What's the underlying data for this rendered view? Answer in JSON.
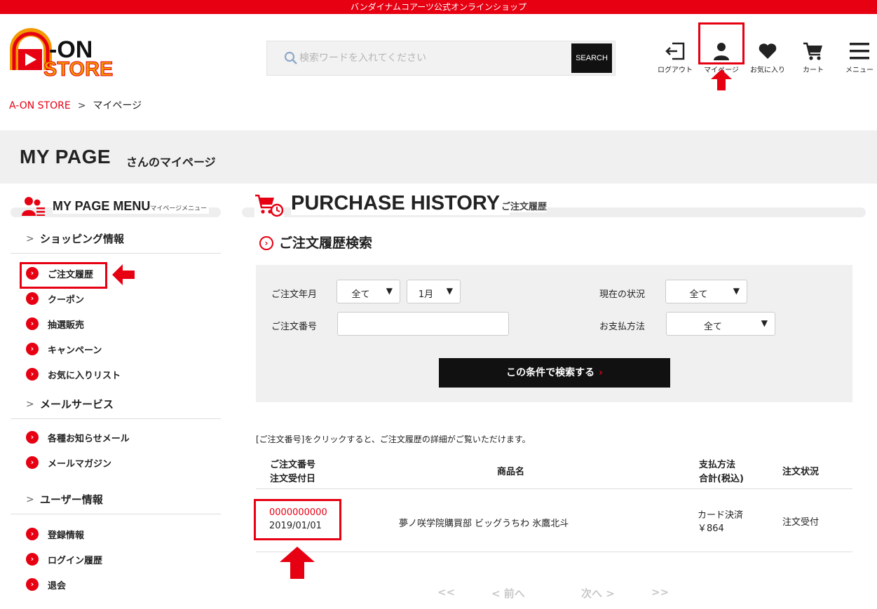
{
  "topbar": {
    "text": "バンダイナムコアーツ公式オンラインショップ"
  },
  "logo": {
    "alt": "A-ON STORE"
  },
  "search": {
    "placeholder": "検索ワードを入れてください",
    "button": "SEARCH"
  },
  "header_icons": [
    {
      "icon": "logout-icon",
      "label": "ログアウト"
    },
    {
      "icon": "user-icon",
      "label": "マイページ"
    },
    {
      "icon": "heart-icon",
      "label": "お気に入り"
    },
    {
      "icon": "cart-icon",
      "label": "カート"
    },
    {
      "icon": "hamburger-icon",
      "label": "メニュー"
    }
  ],
  "breadcrumb": {
    "home": "A-ON STORE",
    "sep": ">",
    "current": "マイページ"
  },
  "page": {
    "title": "MY PAGE",
    "subtitle": "さんのマイページ"
  },
  "sidebar": {
    "title": "MY PAGE MENU",
    "title_sub": "マイページメニュー",
    "sections": [
      {
        "label": "ショッピング情報",
        "items": [
          "ご注文履歴",
          "クーポン",
          "抽選販売",
          "キャンペーン",
          "お気に入りリスト"
        ]
      },
      {
        "label": "メールサービス",
        "items": [
          "各種お知らせメール",
          "メールマガジン"
        ]
      },
      {
        "label": "ユーザー情報",
        "items": [
          "登録情報",
          "ログイン履歴",
          "退会"
        ]
      }
    ]
  },
  "purchase_history": {
    "title": "PURCHASE HISTORY",
    "subtitle": "ご注文履歴",
    "search_heading": "ご注文履歴検索",
    "filters": {
      "order_date_label": "ご注文年月",
      "year_value": "全て",
      "month_value": "1月",
      "order_no_label": "ご注文番号",
      "order_no_value": "",
      "status_label": "現在の状況",
      "status_value": "全て",
      "payment_label": "お支払方法",
      "payment_value": "全て",
      "submit": "この条件で検索する"
    },
    "note": "[ご注文番号]をクリックすると、ご注文履歴の詳細がご覧いただけます。",
    "columns": {
      "order_no": "ご注文番号",
      "order_date": "注文受付日",
      "product": "商品名",
      "payment": "支払方法",
      "total": "合計(税込)",
      "status": "注文状況"
    },
    "rows": [
      {
        "order_no": "0000000000",
        "date": "2019/01/01",
        "product": "夢ノ咲学院購買部 ビッグうちわ 氷鷹北斗",
        "payment": "カード決済",
        "total": "￥864",
        "status": "注文受付"
      }
    ],
    "pager": {
      "first": "<<",
      "prev": "< 前へ",
      "next": "次へ >",
      "last": ">>"
    }
  },
  "colors": {
    "accent": "#e60012",
    "dark": "#111111",
    "band": "#f0f0f0"
  }
}
